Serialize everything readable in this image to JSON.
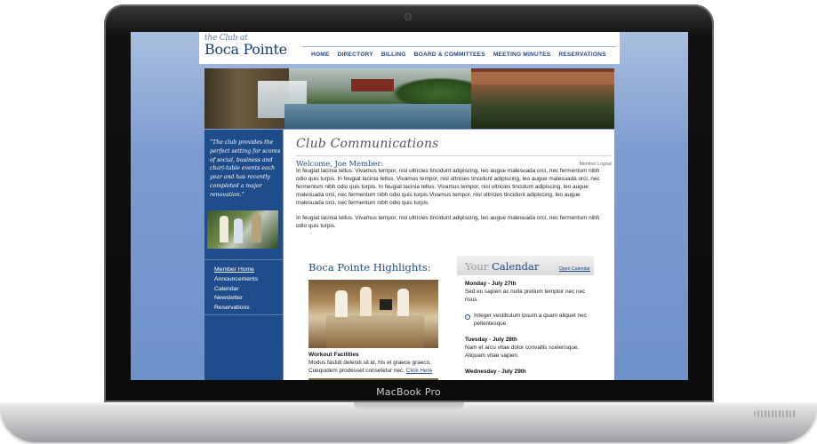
{
  "device": {
    "label": "MacBook Pro"
  },
  "site": {
    "logo": {
      "line1": "the Club at",
      "line2": "Boca Pointe"
    },
    "nav": [
      "HOME",
      "DIRECTORY",
      "BILLING",
      "BOARD & COMMITTEES",
      "MEETING MINUTES",
      "RESERVATIONS"
    ],
    "sidebar": {
      "quote": "“The club provides the perfect setting for scores of social, business and chari-table events each year and has recently completed a major renovation.”",
      "items": [
        "Member Home",
        "Announcements",
        "Calendar",
        "Newsletter",
        "Reservations"
      ]
    },
    "main": {
      "title": "Club Communications",
      "welcome": "Welcome, Joe Member:",
      "logout": "Member Logout",
      "paragraph1": "In feugiat lacinia tellus. Vivamus tempor, nisl ultricies tincidunt adipiscing, leo augue malesuada orci, nec fermentum nibh odio quis turpis. In feugiat lacinia tellus. Vivamus tempor, nisl ultricies tincidunt adipiscing, leo augue malesuada orci, nec fermentum nibh odio quis turpis. In feugiat lacinia tellus. Vivamus tempor, nisl ultricies tincidunt adipiscing, leo augue malesuada orci, nec fermentum nibh odio quis turpis.Vivamus tempor, nisl ultricies tincidunt adipiscing, leo augue malesuada orci, nec fermentum nibh odio quis turpis.",
      "paragraph2": "In feugiat lacinia tellus. Vivamus tempor, nisl ultricies tincidunt adipiscing, leo augue malesuada orci, nec fermentum nibh odio quis turpis.",
      "highlights": {
        "title": "Boca Pointe Highlights:",
        "caption_title": "Workout Facilities",
        "caption": "Modus fastidi deleniti sit id, his et graece graeco. Cuequidem prodesset consetetur nec.",
        "link": "Click Here"
      },
      "calendar": {
        "title_prefix": "Your",
        "title_main": "Calendar",
        "open_link": "Open Calendar",
        "entries": [
          {
            "day": "Monday - July 27th",
            "text": "Sed eu sapien ac nulla pretium temptor nec nec risus."
          },
          {
            "day": "",
            "text": "Integer vestibulum ipsum a quam aliquet nec pellentesque."
          },
          {
            "day": "Tuesday - July 28th",
            "text": "Nam et arcu vitae dolor convallis scelerisque. Aliquam vitae sapien."
          },
          {
            "day": "Wednesday - July 29th",
            "text": ""
          }
        ]
      }
    }
  }
}
